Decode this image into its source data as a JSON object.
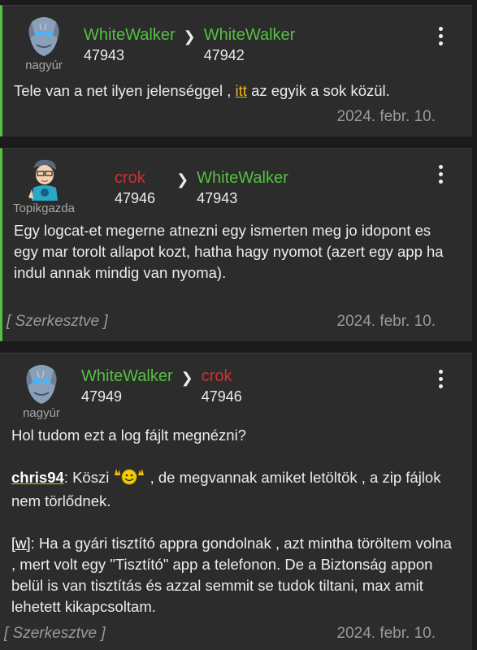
{
  "posts": [
    {
      "rank": "nagyúr",
      "from_user": "WhiteWalker",
      "from_num": "47943",
      "to_user": "WhiteWalker",
      "to_num": "47942",
      "text_before": "Tele van a net ilyen jelenséggel , ",
      "link": "itt",
      "text_after": " az egyik a sok közül.",
      "date": "2024. febr. 10."
    },
    {
      "rank": "Topikgazda",
      "from_user": "crok",
      "from_num": "47946",
      "to_user": "WhiteWalker",
      "to_num": "47943",
      "text": "Egy logcat-et megerne atnezni egy ismerten meg jo idopont es egy mar torolt allapot kozt, hatha hagy nyomot (azert egy app ha indul annak mindig van nyoma).",
      "edited": "[ Szerkesztve ]",
      "date": "2024. febr. 10."
    },
    {
      "rank": "nagyúr",
      "from_user": "WhiteWalker",
      "from_num": "47949",
      "to_user": "crok",
      "to_num": "47946",
      "line1": "Hol tudom ezt a log fájlt megnézni?",
      "mention": "chris94",
      "mention_text_a": ": Köszi ",
      "mention_text_b": " , de megvannak amiket letöltök , a zip fájlok nem törlődnek.",
      "quote": "[w]",
      "quote_text": ": Ha a gyári tisztító appra gondolnak , azt mintha töröltem volna , mert volt egy \"Tisztító\" app a telefonon. De a Biztonság appon belül is van tisztítás és azzal semmit se tudok tiltani, max amit lehetett kikapcsoltam.",
      "edited": "[ Szerkesztve ]",
      "date": "2024. febr. 10."
    }
  ],
  "chevron": "❯",
  "colors": {
    "accent": "#55c043",
    "link": "#e8b321",
    "red_user": "#d03030",
    "card": "#2c2c2c",
    "bg": "#1b1b1b"
  }
}
